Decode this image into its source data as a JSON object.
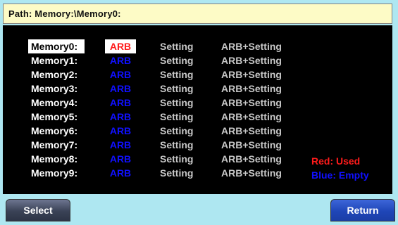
{
  "path": {
    "label": "Path: Memory:\\Memory0:"
  },
  "memories": [
    {
      "name": "Memory0:",
      "arb": "ARB",
      "setting": "Setting",
      "arb_setting": "ARB+Setting",
      "state": "used",
      "selected": true
    },
    {
      "name": "Memory1:",
      "arb": "ARB",
      "setting": "Setting",
      "arb_setting": "ARB+Setting",
      "state": "empty",
      "selected": false
    },
    {
      "name": "Memory2:",
      "arb": "ARB",
      "setting": "Setting",
      "arb_setting": "ARB+Setting",
      "state": "empty",
      "selected": false
    },
    {
      "name": "Memory3:",
      "arb": "ARB",
      "setting": "Setting",
      "arb_setting": "ARB+Setting",
      "state": "empty",
      "selected": false
    },
    {
      "name": "Memory4:",
      "arb": "ARB",
      "setting": "Setting",
      "arb_setting": "ARB+Setting",
      "state": "empty",
      "selected": false
    },
    {
      "name": "Memory5:",
      "arb": "ARB",
      "setting": "Setting",
      "arb_setting": "ARB+Setting",
      "state": "empty",
      "selected": false
    },
    {
      "name": "Memory6:",
      "arb": "ARB",
      "setting": "Setting",
      "arb_setting": "ARB+Setting",
      "state": "empty",
      "selected": false
    },
    {
      "name": "Memory7:",
      "arb": "ARB",
      "setting": "Setting",
      "arb_setting": "ARB+Setting",
      "state": "empty",
      "selected": false
    },
    {
      "name": "Memory8:",
      "arb": "ARB",
      "setting": "Setting",
      "arb_setting": "ARB+Setting",
      "state": "empty",
      "selected": false
    },
    {
      "name": "Memory9:",
      "arb": "ARB",
      "setting": "Setting",
      "arb_setting": "ARB+Setting",
      "state": "empty",
      "selected": false
    }
  ],
  "legend": {
    "used": "Red: Used",
    "empty": "Blue: Empty"
  },
  "softkeys": {
    "select": "Select",
    "return": "Return"
  },
  "colors": {
    "used": "#ff1b1b",
    "empty": "#1010ff",
    "path_bg": "#fdfbc6",
    "screen_bg": "#000000",
    "frame_bg": "#aee7f1"
  }
}
